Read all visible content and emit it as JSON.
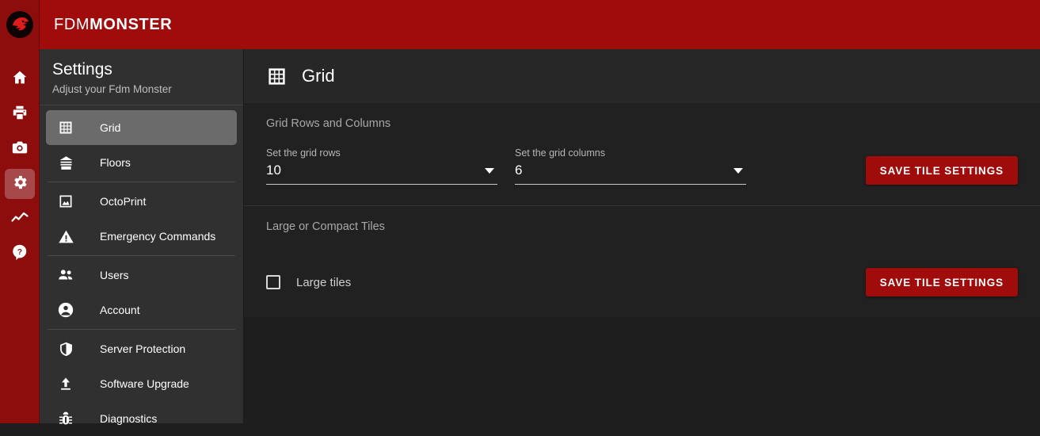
{
  "app": {
    "brand_light": "FDM",
    "brand_bold": "MONSTER",
    "logo_name": "fdm-monster-dragon-logo",
    "accent_red": "#a00b0b",
    "rail_red": "#8d0d0d",
    "sidebar_bg": "#303030",
    "content_bg": "#1e1e1e"
  },
  "rail": {
    "items": [
      {
        "icon": "home-icon",
        "active": false
      },
      {
        "icon": "printer-icon",
        "active": false
      },
      {
        "icon": "camera-icon",
        "active": false
      },
      {
        "icon": "gear-icon",
        "active": true
      },
      {
        "icon": "line-chart-icon",
        "active": false
      },
      {
        "icon": "help-icon",
        "active": false
      }
    ]
  },
  "sidebar": {
    "title": "Settings",
    "subtitle": "Adjust your Fdm Monster",
    "items": [
      {
        "label": "Grid",
        "icon": "grid-icon",
        "active": true
      },
      {
        "label": "Floors",
        "icon": "floors-icon",
        "active": false
      },
      {
        "label": "OctoPrint",
        "icon": "image-icon",
        "active": false
      },
      {
        "label": "Emergency Commands",
        "icon": "warning-triangle-icon",
        "active": false
      },
      {
        "label": "Users",
        "icon": "users-icon",
        "active": false
      },
      {
        "label": "Account",
        "icon": "account-circle-icon",
        "active": false
      },
      {
        "label": "Server Protection",
        "icon": "shield-icon",
        "active": false
      },
      {
        "label": "Software Upgrade",
        "icon": "upload-icon",
        "active": false
      },
      {
        "label": "Diagnostics",
        "icon": "bug-icon",
        "active": false
      }
    ]
  },
  "content": {
    "header": {
      "title": "Grid",
      "icon": "grid-icon"
    },
    "grid_section": {
      "label": "Grid Rows and Columns",
      "rows_field": {
        "label": "Set the grid rows",
        "value": "10"
      },
      "columns_field": {
        "label": "Set the grid columns",
        "value": "6"
      },
      "save_label": "SAVE TILE SETTINGS"
    },
    "tiles_section": {
      "label": "Large or Compact Tiles",
      "checkbox_label": "Large tiles",
      "checked": false,
      "save_label": "SAVE TILE SETTINGS"
    }
  }
}
